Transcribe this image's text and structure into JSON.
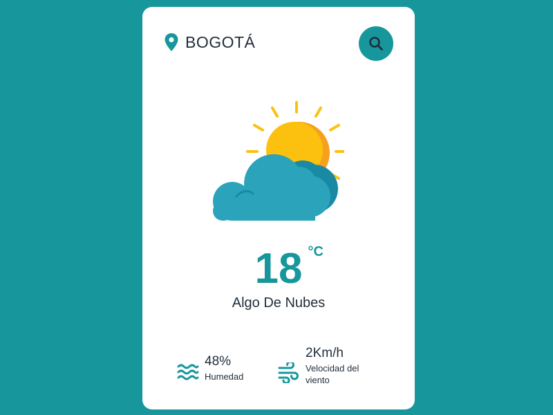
{
  "location": {
    "icon": "map-pin-icon",
    "city": "BOGOTÁ"
  },
  "search": {
    "icon": "search-icon"
  },
  "weather": {
    "icon": "sun-behind-cloud-icon",
    "temperature": "18",
    "unit": "°C",
    "description": "Algo De Nubes"
  },
  "details": {
    "humidity": {
      "icon": "waves-icon",
      "value": "48%",
      "label": "Humedad"
    },
    "wind": {
      "icon": "wind-icon",
      "value": "2Km/h",
      "label": "Velocidad del viento"
    }
  },
  "colors": {
    "background": "#17979c",
    "accent": "#17979c",
    "card": "#ffffff",
    "text": "#1f2d3a",
    "sun": "#fcc10f",
    "cloud": "#2aa3bb"
  }
}
